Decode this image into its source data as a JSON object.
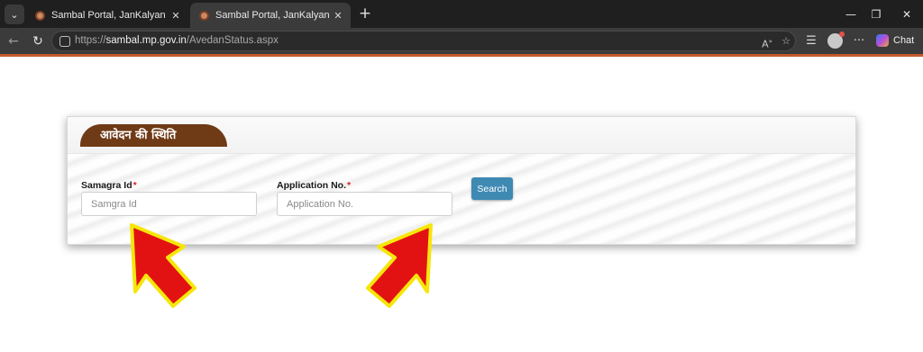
{
  "browser": {
    "tabs": [
      {
        "title": "Sambal Portal, JanKalyan Portal, St",
        "active": false
      },
      {
        "title": "Sambal Portal, JanKalyan Portal, St",
        "active": true
      }
    ],
    "url_prefix": "https://",
    "url_host": "sambal.mp.gov.in",
    "url_path": "/AvedanStatus.aspx",
    "chat_label": "Chat"
  },
  "form": {
    "title": "आवेदन की स्थिति",
    "samagra_label": "Samagra Id",
    "samagra_placeholder": "Samgra Id",
    "application_label": "Application No.",
    "application_placeholder": "Application No.",
    "required_mark": "*",
    "search_label": "Search"
  },
  "colors": {
    "header_brown": "#6f3a16",
    "search_button": "#3f8ab3",
    "arrow_fill": "#e31212",
    "arrow_outline": "#f6e60a"
  }
}
